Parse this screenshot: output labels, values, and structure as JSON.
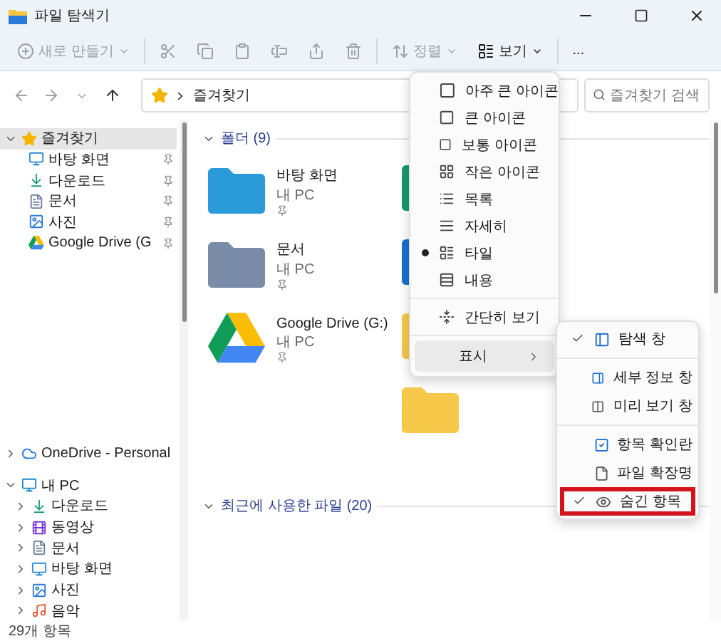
{
  "window": {
    "title": "파일 탐색기"
  },
  "toolbar": [
    {
      "kind": "new",
      "label": "새로 만들기",
      "disabled": true
    },
    {
      "kind": "cut",
      "disabled": true
    },
    {
      "kind": "copy",
      "disabled": true
    },
    {
      "kind": "paste",
      "disabled": true
    },
    {
      "kind": "rename",
      "disabled": true
    },
    {
      "kind": "share",
      "disabled": true
    },
    {
      "kind": "delete",
      "disabled": true
    },
    {
      "kind": "sort",
      "label": "정렬",
      "disabled": true
    },
    {
      "kind": "view",
      "label": "보기",
      "disabled": false
    },
    {
      "kind": "more",
      "label": "...",
      "disabled": false
    }
  ],
  "address": {
    "path": "즐겨찾기",
    "search_placeholder": "즐겨찾기 검색"
  },
  "sidebar": [
    {
      "kind": "star",
      "label": "즐겨찾기",
      "expanded": true,
      "selected": true,
      "children": [
        {
          "kind": "desktop",
          "label": "바탕 화면",
          "pinned": true
        },
        {
          "kind": "download",
          "label": "다운로드",
          "pinned": true
        },
        {
          "kind": "documents",
          "label": "문서",
          "pinned": true
        },
        {
          "kind": "pictures",
          "label": "사진",
          "pinned": true
        },
        {
          "kind": "gdrive",
          "label": "Google Drive (G",
          "pinned": true
        }
      ]
    },
    {
      "kind": "onedrive",
      "label": "OneDrive - Personal",
      "expanded": false,
      "selected": false
    },
    {
      "kind": "pc",
      "label": "내 PC",
      "expanded": true,
      "selected": false,
      "children": [
        {
          "kind": "download",
          "label": "다운로드",
          "expanded": false
        },
        {
          "kind": "videos",
          "label": "동영상",
          "expanded": false
        },
        {
          "kind": "documents",
          "label": "문서",
          "expanded": false
        },
        {
          "kind": "desktop",
          "label": "바탕 화면",
          "expanded": false
        },
        {
          "kind": "pictures",
          "label": "사진",
          "expanded": false
        },
        {
          "kind": "music",
          "label": "음악",
          "expanded": false
        }
      ]
    }
  ],
  "folders": {
    "heading": "폴더 (9)",
    "items": [
      {
        "kind": "desktop",
        "name": "바탕 화면",
        "location": "내 PC",
        "pinned": true
      },
      {
        "kind": "documents",
        "name": "문서",
        "location": "내 PC",
        "pinned": true
      },
      {
        "kind": "gdrive",
        "name": "Google Drive (G:)",
        "location": "내 PC",
        "pinned": true
      }
    ],
    "second_column": [
      {
        "kind": "download"
      },
      {
        "kind": "pictures"
      },
      {
        "kind": "folder"
      },
      {
        "kind": "folder"
      }
    ]
  },
  "recent": {
    "heading": "최근에 사용한 파일 (20)"
  },
  "view_menu": {
    "items": [
      {
        "kind": "xl",
        "label": "아주 큰 아이콘",
        "selected": false
      },
      {
        "kind": "lg",
        "label": "큰 아이콘",
        "selected": false
      },
      {
        "kind": "md",
        "label": "보통 아이콘",
        "selected": false
      },
      {
        "kind": "sm",
        "label": "작은 아이콘",
        "selected": false
      },
      {
        "kind": "list",
        "label": "목록",
        "selected": false
      },
      {
        "kind": "details",
        "label": "자세히",
        "selected": false
      },
      {
        "kind": "tiles",
        "label": "타일",
        "selected": true
      },
      {
        "kind": "content",
        "label": "내용",
        "selected": false
      },
      {
        "kind": "compact",
        "label": "간단히 보기",
        "selected": false
      }
    ],
    "show": {
      "label": "표시",
      "expanded": true
    }
  },
  "show_menu": [
    {
      "kind": "nav",
      "label": "탐색 창",
      "checked": true,
      "highlighted": false
    },
    {
      "kind": "details",
      "label": "세부 정보 창",
      "checked": false,
      "highlighted": false
    },
    {
      "kind": "preview",
      "label": "미리 보기 창",
      "checked": false,
      "highlighted": false
    },
    {
      "kind": "checkbox",
      "label": "항목 확인란",
      "checked": false,
      "highlighted": false
    },
    {
      "kind": "ext",
      "label": "파일 확장명",
      "checked": false,
      "highlighted": false
    },
    {
      "kind": "hidden",
      "label": "숨긴 항목",
      "checked": true,
      "highlighted": true
    }
  ],
  "status_bar": {
    "count": "29개 항목"
  }
}
